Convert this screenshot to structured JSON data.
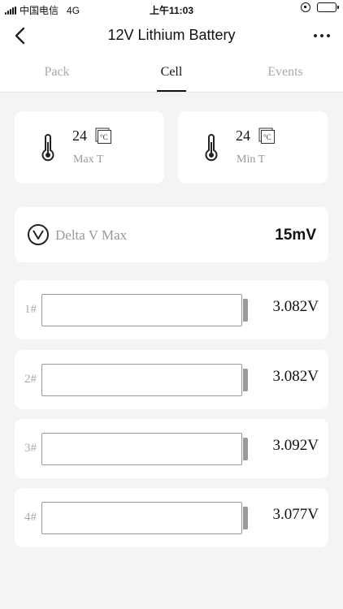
{
  "status_bar": {
    "carrier": "中国电信",
    "network": "4G",
    "time": "上午11:03",
    "battery_level": 0.9
  },
  "header": {
    "title": "12V Lithium Battery"
  },
  "tabs": [
    {
      "label": "Pack",
      "active": false
    },
    {
      "label": "Cell",
      "active": true
    },
    {
      "label": "Events",
      "active": false
    }
  ],
  "temps": {
    "max": {
      "value": "24",
      "unit": "°C",
      "label": "Max T"
    },
    "min": {
      "value": "24",
      "unit": "°C",
      "label": "Min T"
    }
  },
  "delta": {
    "label": "Delta V Max",
    "value": "15mV"
  },
  "cells": [
    {
      "label": "1#",
      "voltage": "3.082V"
    },
    {
      "label": "2#",
      "voltage": "3.082V"
    },
    {
      "label": "3#",
      "voltage": "3.092V"
    },
    {
      "label": "4#",
      "voltage": "3.077V"
    }
  ],
  "icons": {
    "back": "chevron-left-icon",
    "more": "more-dots-icon",
    "thermometer": "thermometer-icon",
    "celsius": "celsius-icon",
    "delta": "check-circle-icon"
  }
}
